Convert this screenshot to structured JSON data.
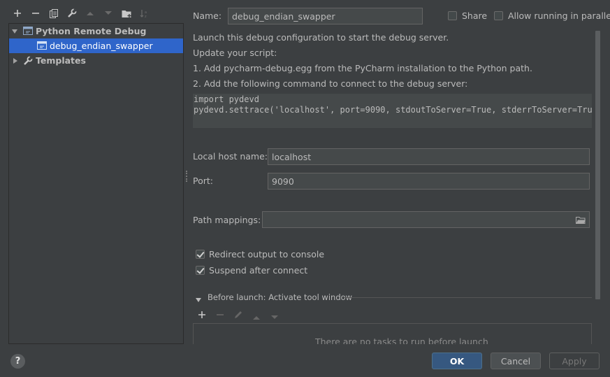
{
  "toolbar": {
    "icons": [
      "add-icon",
      "remove-icon",
      "copy-icon",
      "wrench-icon",
      "move-up-icon",
      "move-down-icon",
      "new-folder-icon",
      "sort-icon"
    ]
  },
  "tree": {
    "group_label": "Python Remote Debug",
    "config_label": "debug_endian_swapper",
    "templates_label": "Templates"
  },
  "header": {
    "name_label": "Name:",
    "name_value": "debug_endian_swapper",
    "share_label": "Share",
    "parallel_label": "Allow running in parallel",
    "share_checked": false,
    "parallel_checked": false
  },
  "instructions": {
    "line1": "Launch this debug configuration to start the debug server.",
    "line2": "Update your script:",
    "line3": "1. Add pycharm-debug.egg from the PyCharm installation to the Python path.",
    "line4": "2. Add the following command to connect to the debug server:",
    "code1": "import pydevd",
    "code2": "pydevd.settrace('localhost', port=9090, stdoutToServer=True, stderrToServer=True)"
  },
  "form": {
    "host_label": "Local host name:",
    "host_value": "localhost",
    "port_label": "Port:",
    "port_value": "9090",
    "path_label": "Path mappings:",
    "path_value": "",
    "redirect_label": "Redirect output to console",
    "redirect_checked": true,
    "suspend_label": "Suspend after connect",
    "suspend_checked": true
  },
  "before_launch": {
    "title": "Before launch: Activate tool window",
    "empty_text": "There are no tasks to run before launch"
  },
  "buttons": {
    "help": "?",
    "ok": "OK",
    "cancel": "Cancel",
    "apply": "Apply"
  },
  "colors": {
    "background": "#3c3f41",
    "selection": "#2f65ca",
    "primary_button": "#365880",
    "field_bg": "#45494a"
  }
}
